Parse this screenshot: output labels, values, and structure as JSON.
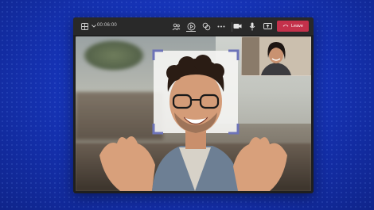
{
  "toolbar": {
    "timer": "00:06:00",
    "leave_label": "Leave",
    "icons": [
      "layout-grid-icon",
      "chevron-down-icon",
      "people-icon",
      "react-icon",
      "share-tray-icon",
      "more-icon",
      "camera-icon",
      "microphone-icon",
      "share-screen-icon",
      "phone-hangup-icon"
    ]
  },
  "colors": {
    "background": "#1634b8",
    "toolbar": "#292929",
    "leave_button": "#c4314b",
    "focus_frame": "#6d73b8"
  }
}
